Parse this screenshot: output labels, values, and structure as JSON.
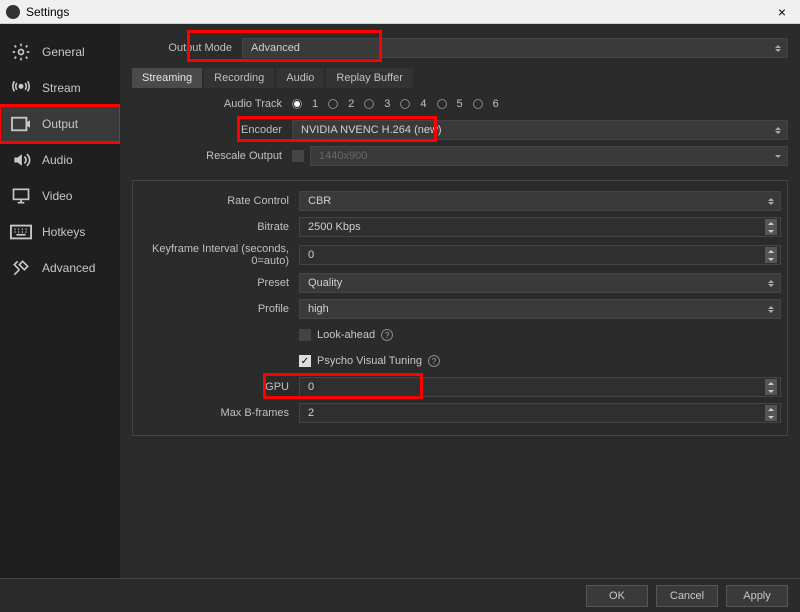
{
  "window": {
    "title": "Settings"
  },
  "sidebar": {
    "items": [
      {
        "label": "General"
      },
      {
        "label": "Stream"
      },
      {
        "label": "Output"
      },
      {
        "label": "Audio"
      },
      {
        "label": "Video"
      },
      {
        "label": "Hotkeys"
      },
      {
        "label": "Advanced"
      }
    ]
  },
  "outputMode": {
    "label": "Output Mode",
    "value": "Advanced"
  },
  "tabs": {
    "streaming": "Streaming",
    "recording": "Recording",
    "audio": "Audio",
    "replay": "Replay Buffer"
  },
  "audioTrack": {
    "label": "Audio Track",
    "options": [
      "1",
      "2",
      "3",
      "4",
      "5",
      "6"
    ],
    "selected": "1"
  },
  "encoder": {
    "label": "Encoder",
    "value": "NVIDIA NVENC H.264 (new)"
  },
  "rescale": {
    "label": "Rescale Output",
    "checked": false,
    "value": "1440x900"
  },
  "rateControl": {
    "label": "Rate Control",
    "value": "CBR"
  },
  "bitrate": {
    "label": "Bitrate",
    "value": "2500 Kbps"
  },
  "keyframe": {
    "label": "Keyframe Interval (seconds, 0=auto)",
    "value": "0"
  },
  "preset": {
    "label": "Preset",
    "value": "Quality"
  },
  "profile": {
    "label": "Profile",
    "value": "high"
  },
  "lookahead": {
    "label": "Look-ahead",
    "checked": false
  },
  "psycho": {
    "label": "Psycho Visual Tuning",
    "checked": true
  },
  "gpu": {
    "label": "GPU",
    "value": "0"
  },
  "bframes": {
    "label": "Max B-frames",
    "value": "2"
  },
  "buttons": {
    "ok": "OK",
    "cancel": "Cancel",
    "apply": "Apply"
  }
}
